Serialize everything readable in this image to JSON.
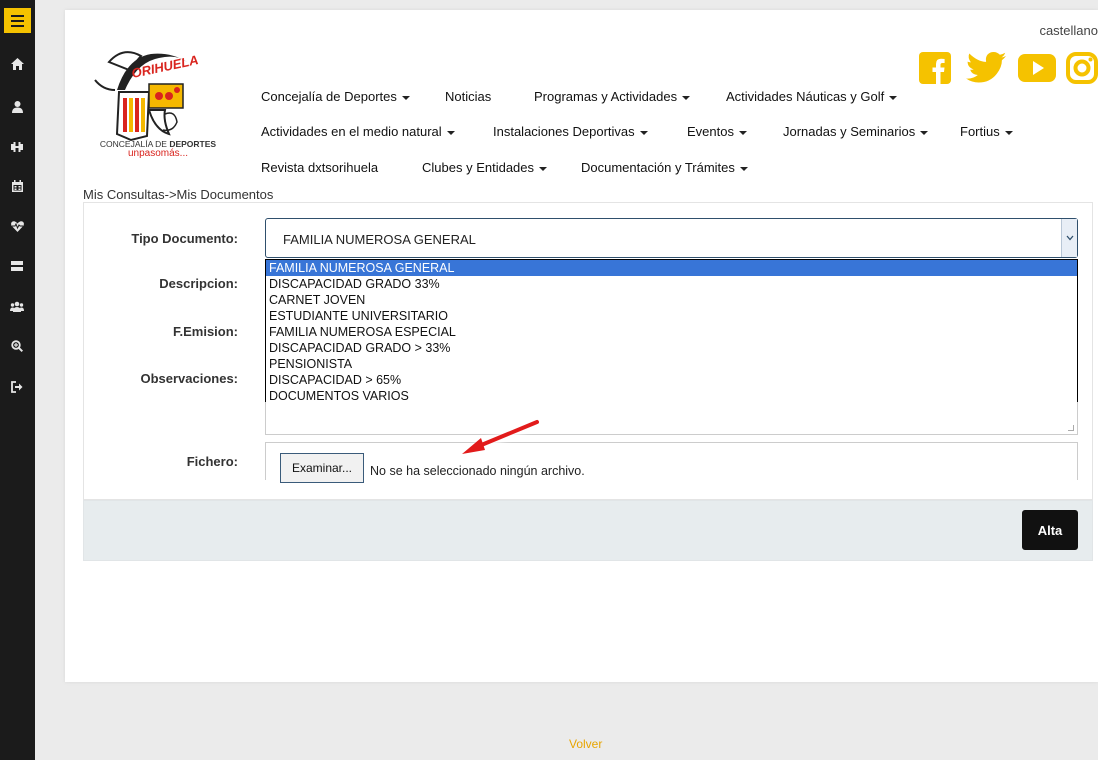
{
  "header": {
    "language": "castellano",
    "social": [
      {
        "icon": "facebook-icon",
        "color": "#f5c200"
      },
      {
        "icon": "twitter-icon",
        "color": "#f5c200"
      },
      {
        "icon": "youtube-icon",
        "color": "#f5c200"
      },
      {
        "icon": "instagram-icon",
        "color": "#f5c200"
      }
    ],
    "logo": {
      "name": "ORIHUELA",
      "line1_prefix": "CONCEJALÍA DE ",
      "line1_emphasis": "DEPORTES",
      "line2": "unpasomás..."
    }
  },
  "nav": {
    "items": [
      {
        "label": "Concejalía de Deportes",
        "dropdown": true
      },
      {
        "label": "Noticias",
        "dropdown": false
      },
      {
        "label": "Programas y Actividades",
        "dropdown": true
      },
      {
        "label": "Actividades Náuticas y Golf",
        "dropdown": true
      },
      {
        "label": "Actividades en el medio natural",
        "dropdown": true
      },
      {
        "label": "Instalaciones Deportivas",
        "dropdown": true
      },
      {
        "label": "Eventos",
        "dropdown": true
      },
      {
        "label": "Jornadas y Seminarios",
        "dropdown": true
      },
      {
        "label": "Fortius",
        "dropdown": true
      },
      {
        "label": "Revista dxtsorihuela",
        "dropdown": false
      },
      {
        "label": "Clubes y Entidades",
        "dropdown": true
      },
      {
        "label": "Documentación y Trámites",
        "dropdown": true
      }
    ]
  },
  "breadcrumb": "Mis Consultas->Mis Documentos",
  "form": {
    "tipo_label": "Tipo Documento:",
    "tipo_value": "FAMILIA NUMEROSA GENERAL",
    "descripcion_label": "Descripcion:",
    "femision_label": "F.Emision:",
    "observaciones_label": "Observaciones:",
    "fichero_label": "Fichero:",
    "file_button": "Examinar...",
    "file_status": "No se ha seleccionado ningún archivo.",
    "options": [
      "FAMILIA NUMEROSA GENERAL",
      "DISCAPACIDAD GRADO 33%",
      "CARNET JOVEN",
      "ESTUDIANTE UNIVERSITARIO",
      "FAMILIA NUMEROSA ESPECIAL",
      "DISCAPACIDAD GRADO > 33%",
      "PENSIONISTA",
      "DISCAPACIDAD > 65%",
      "DOCUMENTOS VARIOS"
    ],
    "selected_option": 0,
    "submit": "Alta"
  },
  "footer": {
    "back_link": "Volver"
  },
  "colors": {
    "accent": "#f5c200",
    "sidebar": "#1b1b1b",
    "selection": "#3875d7",
    "link": "#e8a500"
  }
}
